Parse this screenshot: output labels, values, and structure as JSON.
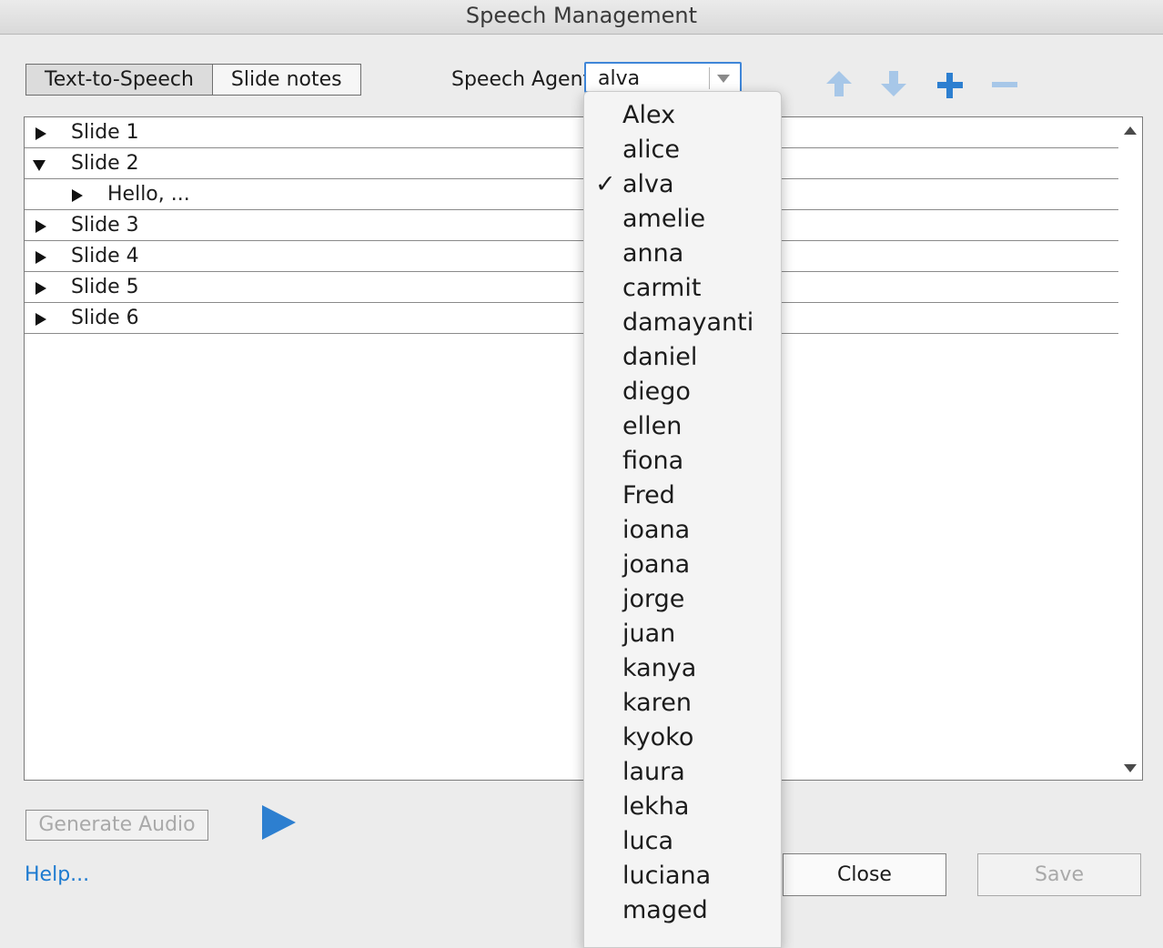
{
  "window": {
    "title": "Speech Management"
  },
  "tabs": [
    {
      "label": "Text-to-Speech",
      "active": true
    },
    {
      "label": "Slide notes",
      "active": false
    }
  ],
  "speech_agent": {
    "label": "Speech Agent",
    "selected": "alva",
    "options": [
      "Alex",
      "alice",
      "alva",
      "amelie",
      "anna",
      "carmit",
      "damayanti",
      "daniel",
      "diego",
      "ellen",
      "fiona",
      "Fred",
      "ioana",
      "joana",
      "jorge",
      "juan",
      "kanya",
      "karen",
      "kyoko",
      "laura",
      "lekha",
      "luca",
      "luciana",
      "maged"
    ]
  },
  "toolbar_icons": [
    "move-up-icon",
    "move-down-icon",
    "add-icon",
    "remove-icon"
  ],
  "slides": [
    {
      "label": "Slide 1",
      "expanded": false
    },
    {
      "label": "Slide 2",
      "expanded": true,
      "children": [
        {
          "label": "Hello, ..."
        }
      ]
    },
    {
      "label": "Slide 3",
      "expanded": false
    },
    {
      "label": "Slide 4",
      "expanded": false
    },
    {
      "label": "Slide 5",
      "expanded": false
    },
    {
      "label": "Slide 6",
      "expanded": false
    }
  ],
  "buttons": {
    "generate_audio": "Generate Audio",
    "help": "Help...",
    "close": "Close",
    "save": "Save"
  },
  "colors": {
    "accent": "#2d7fd0",
    "link": "#1c7ad0",
    "focus": "#3f86d8"
  }
}
